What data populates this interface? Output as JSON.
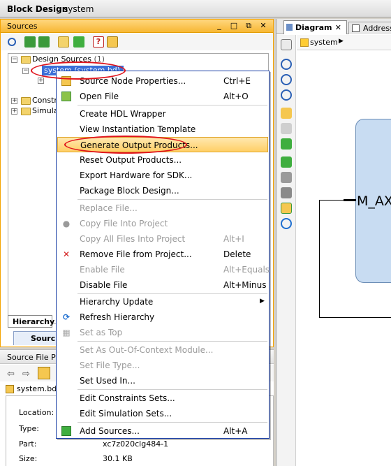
{
  "window": {
    "title": "Block Design",
    "subtitle": "system"
  },
  "sources": {
    "header": "Sources",
    "window_buttons": [
      "_",
      "□",
      "⧉",
      "✕"
    ],
    "tree": {
      "root_label": "Design Sources",
      "root_count": "(1)",
      "selected_node": "system (system.bd) (",
      "constraints_label": "Constra",
      "simulation_label": "Simulati"
    },
    "hierarchy_tab": "Hierarchy",
    "bottom_tab": "Sourc"
  },
  "properties": {
    "header": "Source File Prop",
    "file_name": "system.bd",
    "rows": [
      {
        "key": "Location:",
        "value": ""
      },
      {
        "key": "Type:",
        "value": ""
      },
      {
        "key": "Part:",
        "value": "xc7z020clg484-1"
      },
      {
        "key": "Size:",
        "value": "30.1 KB"
      }
    ]
  },
  "diagram": {
    "tab_label": "Diagram",
    "tab_close": "✕",
    "address_tab": "Address",
    "breadcrumb": "system",
    "block_port_label": "M_AX"
  },
  "menu": {
    "items": [
      {
        "label": "Source Node Properties...",
        "shortcut": "Ctrl+E",
        "disabled": false,
        "icon": "properties-icon"
      },
      {
        "label": "Open File",
        "shortcut": "Alt+O",
        "disabled": false,
        "icon": "open-file-icon"
      },
      {
        "label": "Create HDL Wrapper",
        "shortcut": "",
        "disabled": false
      },
      {
        "label": "View Instantiation Template",
        "shortcut": "",
        "disabled": false
      },
      {
        "label": "Generate Output Products...",
        "shortcut": "",
        "disabled": false,
        "highlighted": true
      },
      {
        "label": "Reset Output Products...",
        "shortcut": "",
        "disabled": false
      },
      {
        "label": "Export Hardware for SDK...",
        "shortcut": "",
        "disabled": false
      },
      {
        "label": "Package Block Design...",
        "shortcut": "",
        "disabled": false
      },
      {
        "label": "Replace File...",
        "shortcut": "",
        "disabled": true
      },
      {
        "label": "Copy File Into Project",
        "shortcut": "",
        "disabled": true,
        "icon": "dot-icon"
      },
      {
        "label": "Copy All Files Into Project",
        "shortcut": "Alt+I",
        "disabled": true
      },
      {
        "label": "Remove File from Project...",
        "shortcut": "Delete",
        "disabled": false,
        "icon": "delete-icon"
      },
      {
        "label": "Enable File",
        "shortcut": "Alt+Equals",
        "disabled": true
      },
      {
        "label": "Disable File",
        "shortcut": "Alt+Minus",
        "disabled": false
      },
      {
        "label": "Hierarchy Update",
        "shortcut": "",
        "disabled": false,
        "submenu": true
      },
      {
        "label": "Refresh Hierarchy",
        "shortcut": "",
        "disabled": false,
        "icon": "refresh-icon"
      },
      {
        "label": "Set as Top",
        "shortcut": "",
        "disabled": true,
        "icon": "set-top-icon"
      },
      {
        "label": "Set As Out-Of-Context Module...",
        "shortcut": "",
        "disabled": true
      },
      {
        "label": "Set File Type...",
        "shortcut": "",
        "disabled": true
      },
      {
        "label": "Set Used In...",
        "shortcut": "",
        "disabled": false
      },
      {
        "label": "Edit Constraints Sets...",
        "shortcut": "",
        "disabled": false
      },
      {
        "label": "Edit Simulation Sets...",
        "shortcut": "",
        "disabled": false
      },
      {
        "label": "Add Sources...",
        "shortcut": "Alt+A",
        "disabled": false,
        "icon": "add-sources-icon"
      }
    ]
  },
  "colors": {
    "accent_orange": "#f7b733",
    "selection_blue": "#3a6fd8",
    "annotation_red": "#e0141c",
    "menu_highlight": "#ffcf66"
  }
}
